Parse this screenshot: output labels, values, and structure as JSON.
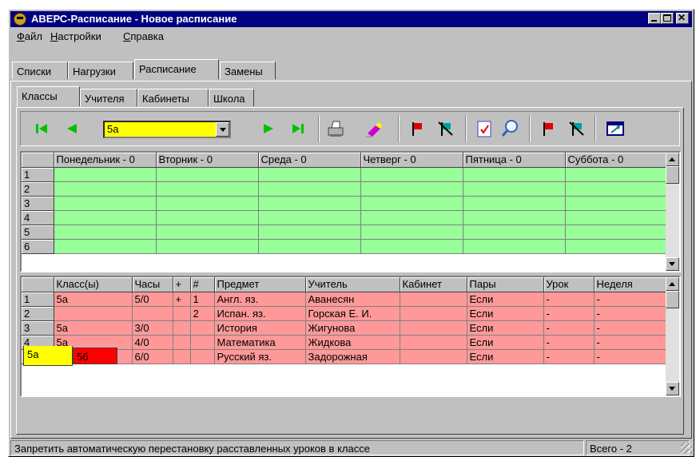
{
  "window": {
    "title": "АВЕРС-Расписание - Новое расписание"
  },
  "menu": [
    {
      "label": "Файл",
      "key": "Ф",
      "rest": "айл"
    },
    {
      "label": "Настройки",
      "key": "Н",
      "rest": "астройки"
    },
    {
      "label": "Справка",
      "key": "С",
      "rest": "правка"
    }
  ],
  "main_tabs": [
    "Списки",
    "Нагрузки",
    "Расписание",
    "Замены"
  ],
  "main_tab_active": "Расписание",
  "sub_tabs": [
    "Классы",
    "Учителя",
    "Кабинеты",
    "Школа"
  ],
  "sub_tab_active": "Классы",
  "toolbar": {
    "selected_class": "5а",
    "colors": {
      "select_bg": "#ffff00",
      "nav": "#00c000"
    }
  },
  "schedule_grid": {
    "headers": [
      "Понедельник - 0",
      "Вторник - 0",
      "Среда - 0",
      "Четверг - 0",
      "Пятница - 0",
      "Суббота - 0"
    ],
    "rows": [
      "1",
      "2",
      "3",
      "4",
      "5",
      "6"
    ],
    "cell_color": "#99ff99"
  },
  "lessons_grid": {
    "headers": [
      "Класс(ы)",
      "Часы",
      "+",
      "#",
      "Предмет",
      "Учитель",
      "Кабинет",
      "Пары",
      "Урок",
      "Неделя"
    ],
    "rows": [
      {
        "n": "1",
        "cls": "5а",
        "hours": "5/0",
        "plus": "+",
        "num": "1",
        "subject": "Англ. яз.",
        "teacher": "Аванесян",
        "room": "",
        "pairs": "Если",
        "lesson": "-",
        "week": "-"
      },
      {
        "n": "2",
        "cls": "",
        "hours": "",
        "plus": "",
        "num": "2",
        "subject": "Испан. яз.",
        "teacher": "Горская Е. И.",
        "room": "",
        "pairs": "Если",
        "lesson": "-",
        "week": "-"
      },
      {
        "n": "3",
        "cls": "5а",
        "hours": "3/0",
        "plus": "",
        "num": "",
        "subject": "История",
        "teacher": "Жигунова",
        "room": "",
        "pairs": "Если",
        "lesson": "-",
        "week": "-"
      },
      {
        "n": "4",
        "cls": "5а",
        "hours": "4/0",
        "plus": "",
        "num": "",
        "subject": "Математика",
        "teacher": "Жидкова",
        "room": "",
        "pairs": "Если",
        "lesson": "-",
        "week": "-"
      },
      {
        "n": "5",
        "cls": "5а",
        "hours": "6/0",
        "plus": "",
        "num": "",
        "subject": "Русский яз.",
        "teacher": "Задорожная",
        "room": "",
        "pairs": "Если",
        "lesson": "-",
        "week": "-"
      }
    ],
    "cell_color": "#ff9999"
  },
  "class_tabs": [
    {
      "label": "5а",
      "color": "#ffff00"
    },
    {
      "label": "5б",
      "color": "#ff0000"
    }
  ],
  "status": {
    "hint": "Запретить автоматическую перестановку расставленных уроков в классе",
    "total": "Всего - 2"
  }
}
